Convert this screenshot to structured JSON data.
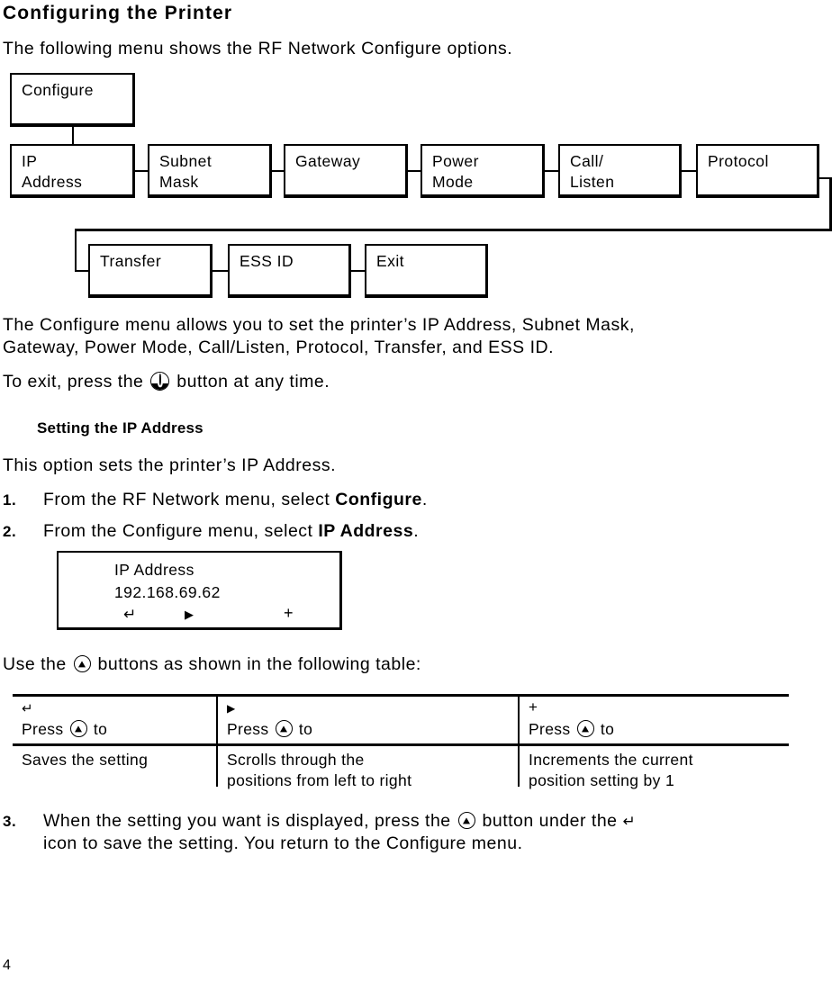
{
  "document": {
    "title": "Configuring the Printer",
    "intro": "The following menu shows the RF Network Configure options.",
    "page_number": "4"
  },
  "diagram": {
    "name": "rf-network-configure-menu-flow",
    "root": {
      "label": "Configure"
    },
    "row1": [
      {
        "label_line1": "IP",
        "label_line2": "Address"
      },
      {
        "label_line1": "Subnet",
        "label_line2": "Mask"
      },
      {
        "label_line1": "Gateway",
        "label_line2": ""
      },
      {
        "label_line1": "Power",
        "label_line2": "Mode"
      },
      {
        "label_line1": "Call/",
        "label_line2": "Listen"
      },
      {
        "label_line1": "Protocol",
        "label_line2": ""
      }
    ],
    "row2": [
      {
        "label_line1": "Transfer",
        "label_line2": ""
      },
      {
        "label_line1": "ESS ID",
        "label_line2": ""
      },
      {
        "label_line1": "Exit",
        "label_line2": ""
      }
    ]
  },
  "body": {
    "para1_line1": "The Configure menu allows you to set the printer’s IP Address, Subnet Mask,",
    "para1_line2": "Gateway, Power Mode, Call/Listen, Protocol, Transfer, and ESS ID.",
    "para2_before_icon": "To exit, press the",
    "para2_after_icon": "button at any time."
  },
  "section": {
    "heading": "Setting the IP Address",
    "lead": "This option sets the printer’s IP Address."
  },
  "steps": [
    {
      "number": "1.",
      "text_before_bold": "From the RF Network menu, select ",
      "bold": "Configure",
      "text_after_bold": "."
    },
    {
      "number": "2.",
      "text_before_bold": "From the Configure menu, select ",
      "bold": "IP Address",
      "text_after_bold": "."
    },
    {
      "number": "3.",
      "line1_before_icon": "When the setting you want is displayed, press the",
      "line1_after_icon": "button under the",
      "line1_end_symbol": "↵",
      "line2": "icon to save the setting.  You return to the Configure menu."
    }
  ],
  "lcd_display": {
    "line1": "IP Address",
    "line2": "192.168.69.62",
    "symbols": [
      "↵",
      "▶",
      "+"
    ]
  },
  "table_intro": {
    "before_icon": "Use the",
    "after_icon": "buttons as shown in the following table:"
  },
  "table": {
    "columns": [
      {
        "symbol": "↵",
        "header_before_icon": "Press",
        "header_after_icon": "to",
        "description_line1": "Saves the setting",
        "description_line2": ""
      },
      {
        "symbol": "▶",
        "header_before_icon": "Press",
        "header_after_icon": "to",
        "description_line1": "Scrolls through the",
        "description_line2": "positions from left to right"
      },
      {
        "symbol": "+",
        "header_before_icon": "Press",
        "header_after_icon": "to",
        "description_line1": "Increments the current",
        "description_line2": "position setting by 1"
      }
    ]
  },
  "icons": {
    "button_icon": "circle-up-triangle-button-icon",
    "exit_icon": "exit-button-icon",
    "enter_symbol": "enter-return-arrow-icon",
    "right_symbol": "right-triangle-icon",
    "plus_symbol": "plus-icon"
  }
}
